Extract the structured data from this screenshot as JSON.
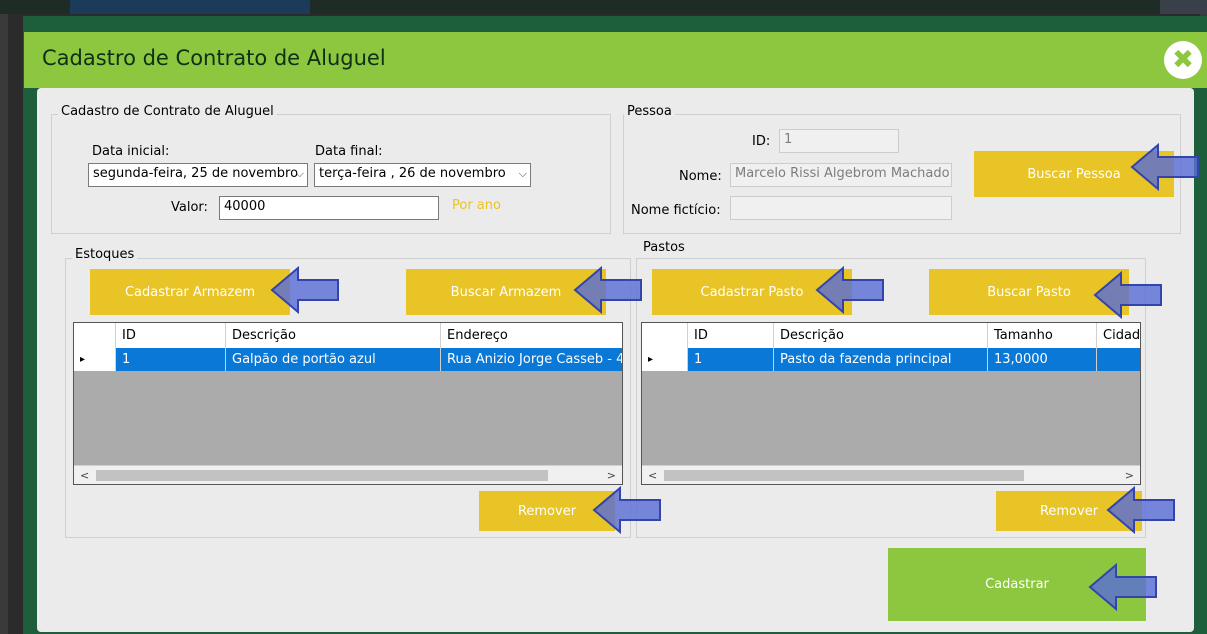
{
  "window": {
    "title": "Cadastro de Contrato de Aluguel",
    "close_glyph": "✖"
  },
  "contract": {
    "group_title": "Cadastro de Contrato de Aluguel",
    "start_label": "Data inicial:",
    "start_value": "segunda-feira, 25 de novembro",
    "end_label": "Data final:",
    "end_value": "terça-feira   , 26 de novembro",
    "value_label": "Valor:",
    "value": "40000",
    "period_label": "Por ano"
  },
  "person": {
    "group_title": "Pessoa",
    "id_label": "ID:",
    "id_value": "1",
    "name_label": "Nome:",
    "name_value": "Marcelo Rissi Algebrom Machado",
    "fantasy_label": "Nome fictício:",
    "fantasy_value": "",
    "search_button": "Buscar Pessoa"
  },
  "stocks": {
    "group_title": "Estoques",
    "register_button": "Cadastrar Armazem",
    "search_button": "Buscar Armazem",
    "remove_button": "Remover",
    "columns": [
      "ID",
      "Descrição",
      "Endereço"
    ],
    "rows": [
      [
        "1",
        "Galpão de portão azul",
        "Rua Anizio Jorge Casseb - 4"
      ]
    ]
  },
  "pastures": {
    "group_title": "Pastos",
    "register_button": "Cadastrar Pasto",
    "search_button": "Buscar Pasto",
    "remove_button": "Remover",
    "columns": [
      "ID",
      "Descrição",
      "Tamanho",
      "Cidad"
    ],
    "rows": [
      [
        "1",
        "Pasto da fazenda principal",
        "13,0000",
        ""
      ]
    ]
  },
  "actions": {
    "submit_button": "Cadastrar"
  },
  "glyphs": {
    "row_marker": "▸",
    "combo_arrow": "⌵",
    "scroll_left": "<",
    "scroll_right": ">"
  },
  "colors": {
    "title_bar": "#8dc63f",
    "button_yellow": "#e8c426",
    "button_green": "#8dc63f",
    "selection": "#0a78d7",
    "annotation_arrow": "#5a6fd6"
  }
}
